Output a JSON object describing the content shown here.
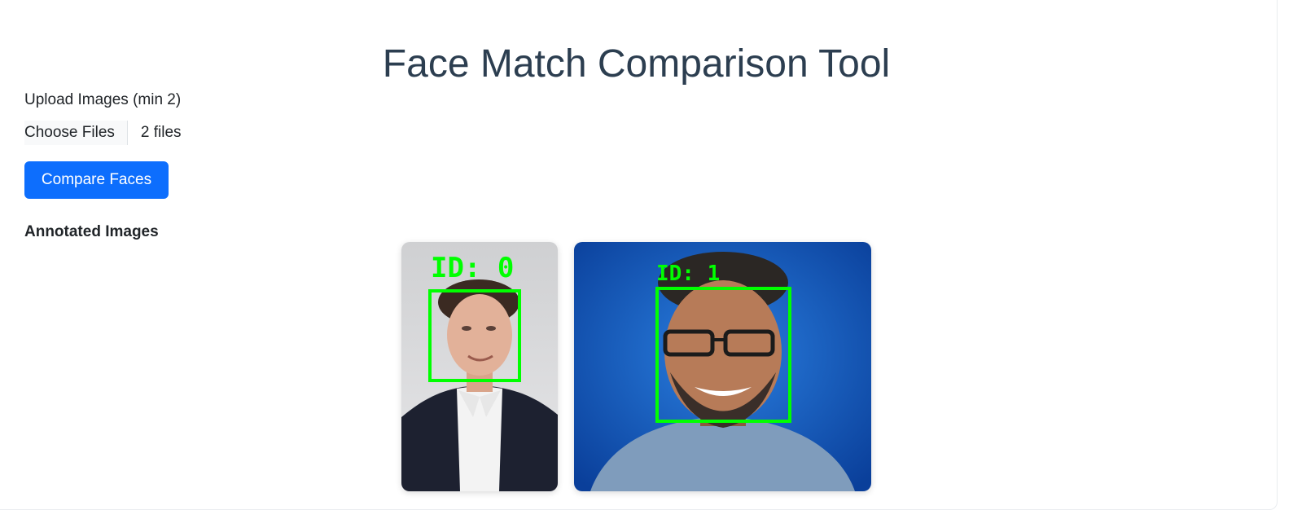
{
  "page": {
    "title": "Face Match Comparison Tool"
  },
  "upload": {
    "label": "Upload Images (min 2)",
    "choose_label": "Choose Files",
    "file_status": "2 files"
  },
  "actions": {
    "compare_label": "Compare Faces"
  },
  "results": {
    "heading": "Annotated Images",
    "images": [
      {
        "face_label": "ID: 0"
      },
      {
        "face_label": "ID: 1"
      }
    ]
  },
  "colors": {
    "primary": "#0d6efd",
    "title": "#2c3e50",
    "annotation": "#00ff00"
  }
}
